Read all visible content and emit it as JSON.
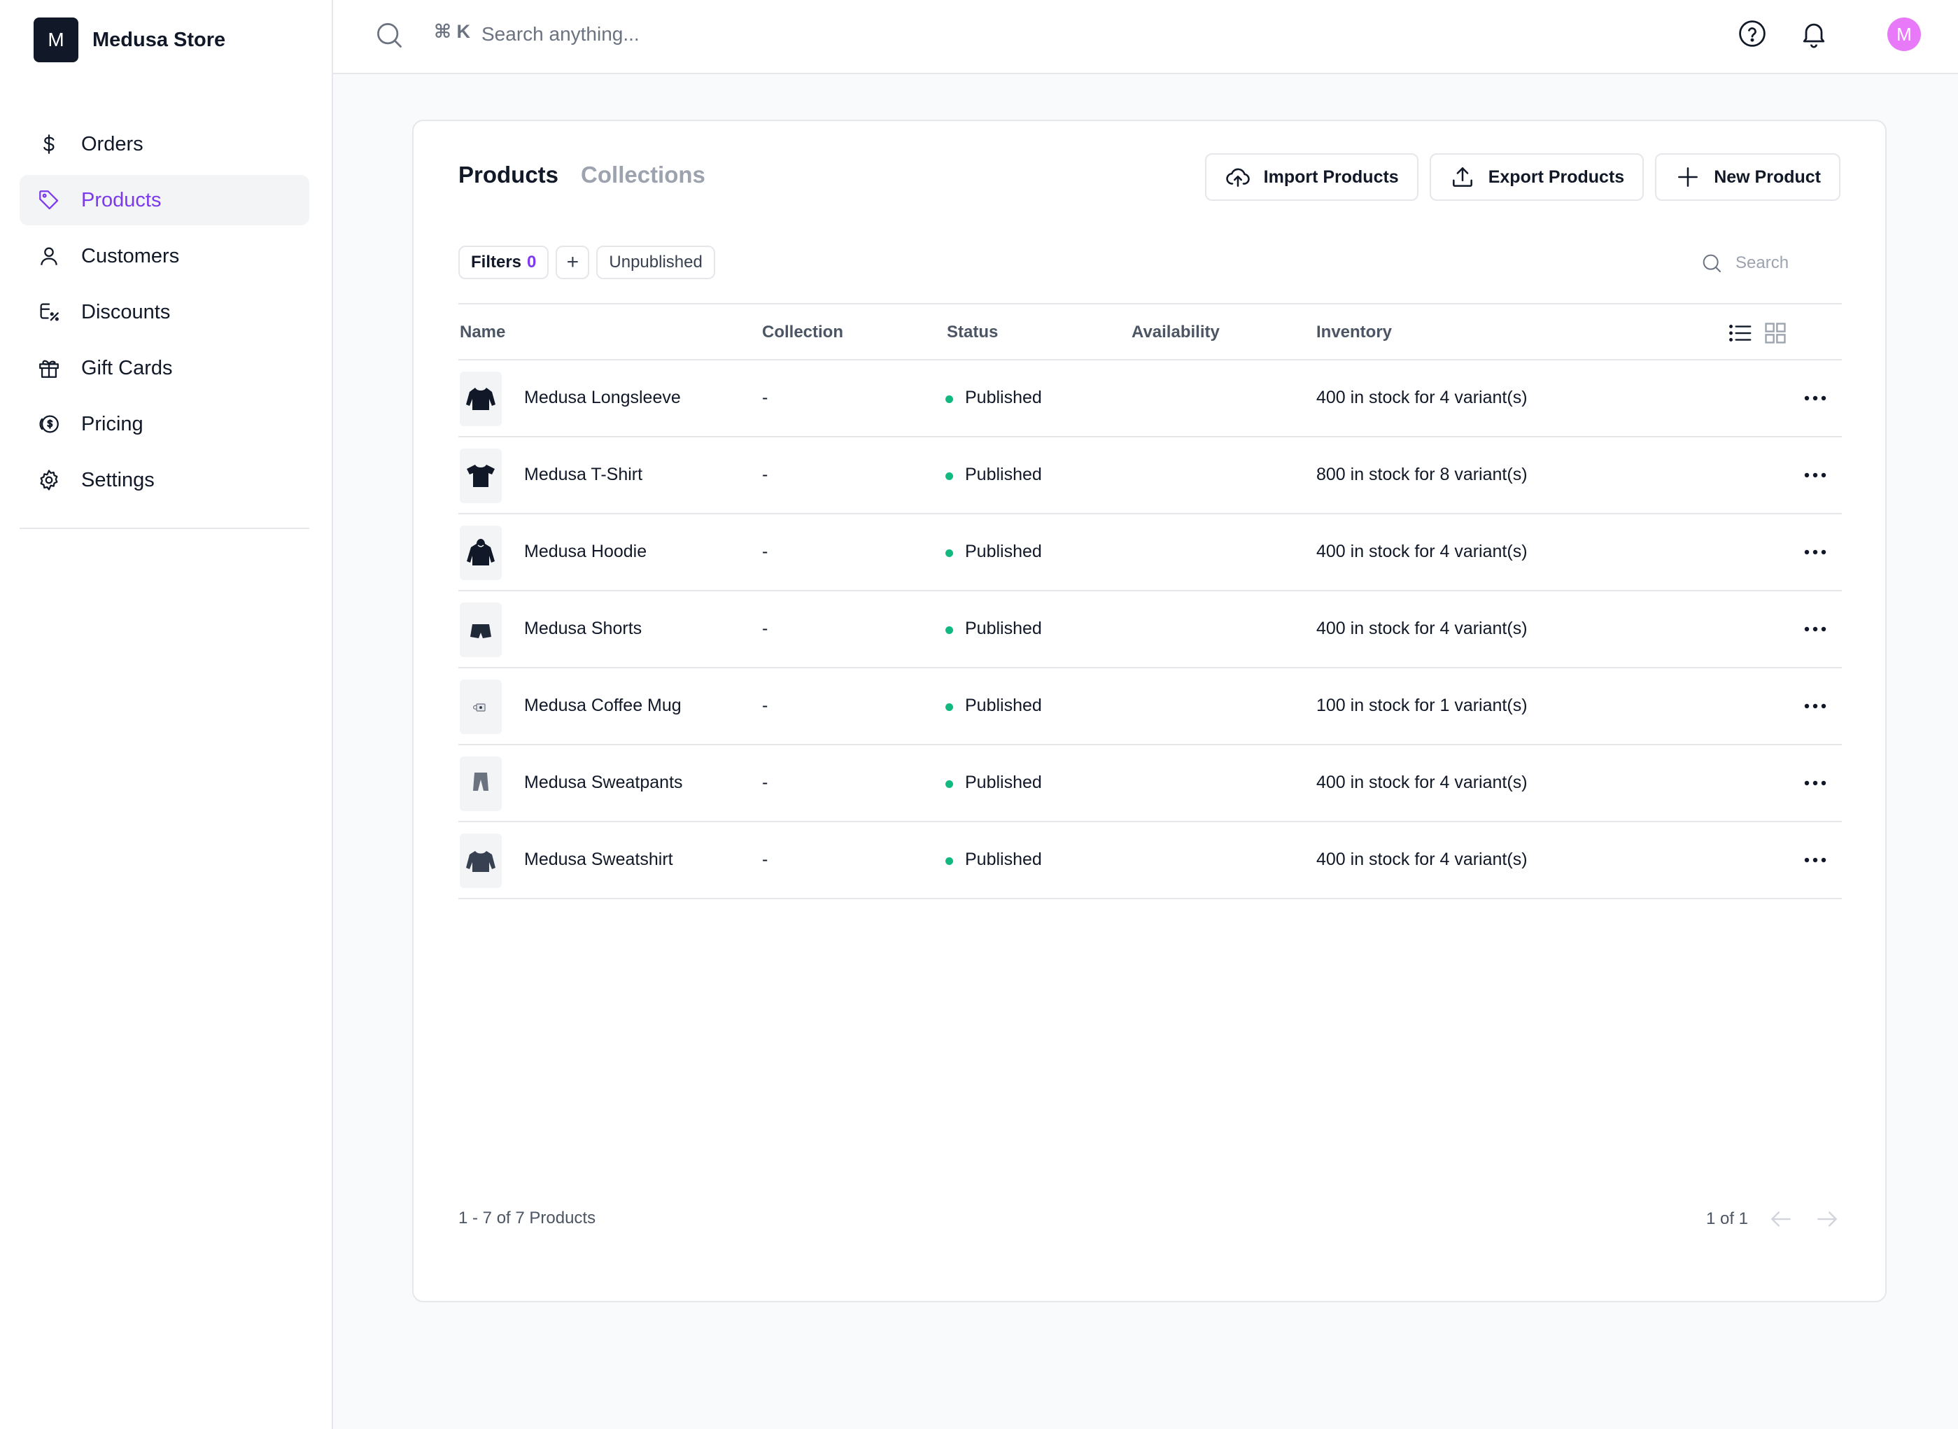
{
  "brand": {
    "initial": "M",
    "name": "Medusa Store"
  },
  "nav": {
    "items": [
      {
        "label": "Orders",
        "icon": "dollar-icon"
      },
      {
        "label": "Products",
        "icon": "tag-icon",
        "active": true
      },
      {
        "label": "Customers",
        "icon": "user-icon"
      },
      {
        "label": "Discounts",
        "icon": "discount-icon"
      },
      {
        "label": "Gift Cards",
        "icon": "gift-icon"
      },
      {
        "label": "Pricing",
        "icon": "pricing-icon"
      },
      {
        "label": "Settings",
        "icon": "gear-icon"
      }
    ]
  },
  "topbar": {
    "shortcut": "⌘ K",
    "search_placeholder": "Search anything...",
    "avatar_initial": "M"
  },
  "main": {
    "tabs": [
      {
        "label": "Products",
        "active": true
      },
      {
        "label": "Collections",
        "active": false
      }
    ],
    "actions": {
      "import_label": "Import Products",
      "export_label": "Export Products",
      "new_label": "New Product"
    },
    "filters": {
      "label": "Filters",
      "count": "0",
      "add": "+",
      "tag": "Unpublished"
    },
    "search_placeholder": "Search",
    "columns": {
      "name": "Name",
      "collection": "Collection",
      "status": "Status",
      "availability": "Availability",
      "inventory": "Inventory"
    },
    "rows": [
      {
        "name": "Medusa Longsleeve",
        "collection": "-",
        "status": "Published",
        "availability": "",
        "inventory": "400 in stock for 4 variant(s)",
        "thumb": "longsleeve"
      },
      {
        "name": "Medusa T-Shirt",
        "collection": "-",
        "status": "Published",
        "availability": "",
        "inventory": "800 in stock for 8 variant(s)",
        "thumb": "tshirt"
      },
      {
        "name": "Medusa Hoodie",
        "collection": "-",
        "status": "Published",
        "availability": "",
        "inventory": "400 in stock for 4 variant(s)",
        "thumb": "hoodie"
      },
      {
        "name": "Medusa Shorts",
        "collection": "-",
        "status": "Published",
        "availability": "",
        "inventory": "400 in stock for 4 variant(s)",
        "thumb": "shorts"
      },
      {
        "name": "Medusa Coffee Mug",
        "collection": "-",
        "status": "Published",
        "availability": "",
        "inventory": "100 in stock for 1 variant(s)",
        "thumb": "mug"
      },
      {
        "name": "Medusa Sweatpants",
        "collection": "-",
        "status": "Published",
        "availability": "",
        "inventory": "400 in stock for 4 variant(s)",
        "thumb": "sweatpants"
      },
      {
        "name": "Medusa Sweatshirt",
        "collection": "-",
        "status": "Published",
        "availability": "",
        "inventory": "400 in stock for 4 variant(s)",
        "thumb": "sweatshirt"
      }
    ],
    "footer": {
      "count_text": "1 - 7 of 7 Products",
      "page_text": "1 of 1"
    }
  },
  "colors": {
    "accent": "#7c3aed",
    "status_published": "#10b981",
    "avatar": "#e879f9"
  }
}
